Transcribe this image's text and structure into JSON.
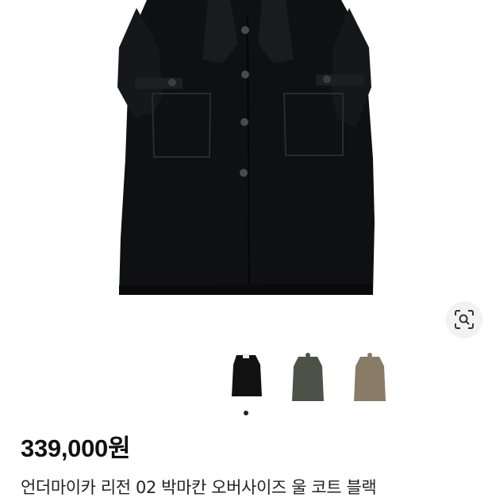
{
  "product": {
    "main_image": "black-wool-coat-photo",
    "price": "339,000원",
    "title": "언더마이카 리전 02 박마칸 오버사이즈 울 코트 블랙"
  },
  "lens_button": {
    "icon": "visual-search-icon"
  },
  "thumbnails": [
    {
      "color_name": "black",
      "fill": "#111111"
    },
    {
      "color_name": "olive",
      "fill": "#4d5148"
    },
    {
      "color_name": "taupe",
      "fill": "#8a7a68"
    }
  ],
  "pagination": {
    "active_index": 0,
    "count": 1
  }
}
